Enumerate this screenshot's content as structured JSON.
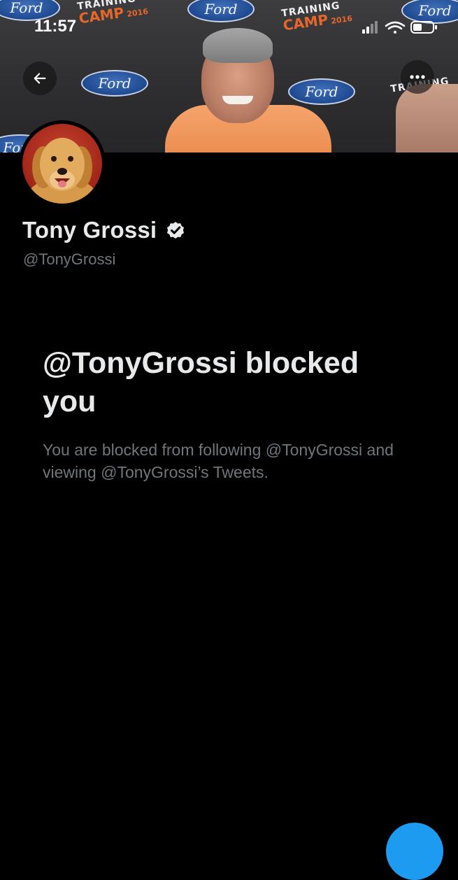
{
  "status_bar": {
    "time": "11:57"
  },
  "banner": {
    "brand_text": "Ford",
    "camp_line1": "TRAINING",
    "camp_line2": "CAMP",
    "camp_year": "2016"
  },
  "profile": {
    "display_name": "Tony Grossi",
    "handle": "@TonyGrossi",
    "verified": true
  },
  "blocked": {
    "title": "@TonyGrossi blocked you",
    "description": "You are blocked from following @TonyGrossi and viewing @TonyGrossi’s Tweets."
  },
  "icons": {
    "back": "back-arrow-icon",
    "more": "more-dots-icon",
    "verified": "verified-badge-icon",
    "signal": "signal-icon",
    "wifi": "wifi-icon",
    "battery": "battery-icon",
    "compose": "compose-icon"
  },
  "colors": {
    "background": "#000000",
    "primary_text": "#e7e9ea",
    "secondary_text": "#71767b",
    "accent": "#1d9bf0",
    "shirt": "#f5a46c"
  }
}
